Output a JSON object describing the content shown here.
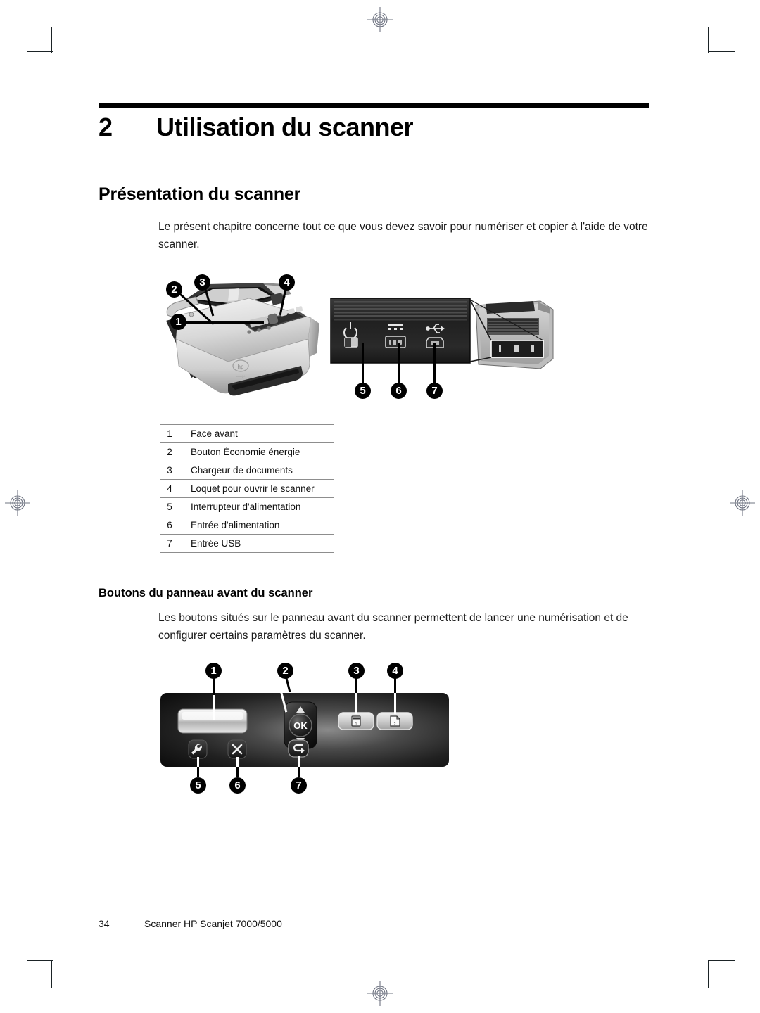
{
  "document": {
    "chapter_number": "2",
    "chapter_title": "Utilisation du scanner",
    "heading_1": "Présentation du scanner",
    "intro_paragraph": "Le présent chapitre concerne tout ce que vous devez savoir pour numériser et copier à l'aide de votre scanner.",
    "heading_2": "Boutons du panneau avant du scanner",
    "buttons_paragraph": "Les boutons situés sur le panneau avant du scanner permettent de lancer une numérisation et de configurer certains paramètres du scanner."
  },
  "legend_table": {
    "rows": [
      {
        "num": "1",
        "label": "Face avant"
      },
      {
        "num": "2",
        "label": "Bouton Économie énergie"
      },
      {
        "num": "3",
        "label": "Chargeur de documents"
      },
      {
        "num": "4",
        "label": "Loquet pour ouvrir le scanner"
      },
      {
        "num": "5",
        "label": "Interrupteur d'alimentation"
      },
      {
        "num": "6",
        "label": "Entrée d'alimentation"
      },
      {
        "num": "7",
        "label": "Entrée USB"
      }
    ]
  },
  "figure_scanner": {
    "callouts": [
      "1",
      "2",
      "3",
      "4"
    ]
  },
  "figure_rear": {
    "callouts": [
      "5",
      "6",
      "7"
    ],
    "port_icons": [
      "power-switch-icon",
      "dc-power-jack-icon",
      "usb-icon"
    ]
  },
  "figure_control_panel": {
    "callouts": [
      "1",
      "2",
      "3",
      "4",
      "5",
      "6",
      "7"
    ],
    "ok_label": "OK",
    "button_icons": [
      "lcd-display",
      "dpad-navigation",
      "scan-simplex-icon",
      "scan-duplex-icon",
      "tools-wrench-icon",
      "cancel-x-icon",
      "back-arrow-icon"
    ]
  },
  "footer": {
    "page_number": "34",
    "text": "Scanner HP Scanjet 7000/5000"
  },
  "colors": {
    "rule": "#000000",
    "table_border": "#8d8d8d",
    "text": "#111111",
    "crop_mark": "#1b2326",
    "registration": "#6f7482"
  }
}
